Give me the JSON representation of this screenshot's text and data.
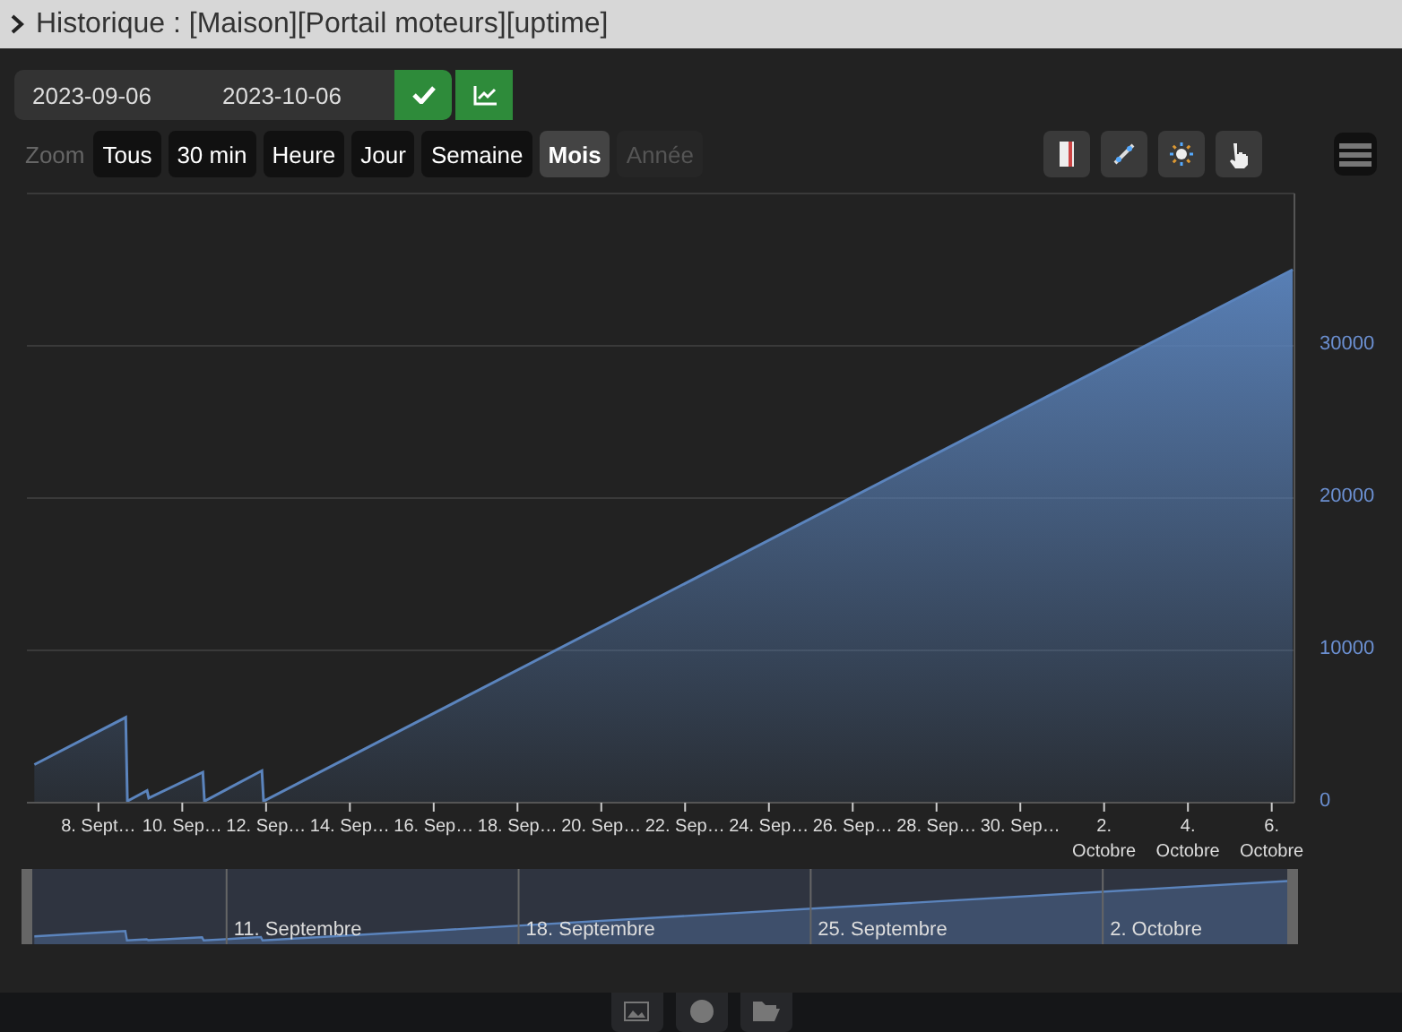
{
  "window": {
    "title": "Historique : [Maison][Portail moteurs][uptime]"
  },
  "date_range": {
    "start": "2023-09-06",
    "end": "2023-10-06"
  },
  "zoom": {
    "label": "Zoom",
    "options": [
      {
        "label": "Tous",
        "selected": false,
        "disabled": false
      },
      {
        "label": "30 min",
        "selected": false,
        "disabled": false
      },
      {
        "label": "Heure",
        "selected": false,
        "disabled": false
      },
      {
        "label": "Jour",
        "selected": false,
        "disabled": false
      },
      {
        "label": "Semaine",
        "selected": false,
        "disabled": false
      },
      {
        "label": "Mois",
        "selected": true,
        "disabled": false
      },
      {
        "label": "Année",
        "selected": false,
        "disabled": true
      }
    ]
  },
  "tools": [
    {
      "kind": "ruler"
    },
    {
      "kind": "line"
    },
    {
      "kind": "sun"
    },
    {
      "kind": "hand"
    }
  ],
  "chart_data": {
    "type": "area",
    "x": [
      "2023-09-06T11:17",
      "2023-09-08T15:36",
      "2023-09-08T16:34",
      "2023-09-09T03:50",
      "2023-09-09T04:48",
      "2023-09-10T11:46",
      "2023-09-10T12:43",
      "2023-09-11T21:36",
      "2023-09-11T22:34",
      "2023-10-06T12:00"
    ],
    "series": [
      {
        "color": "#5b84bd",
        "values": [
          2500,
          5600,
          100,
          800,
          300,
          2000,
          100,
          2100,
          100,
          35000
        ]
      }
    ],
    "xlim": [
      "2023-09-06T07:00",
      "2023-10-06T13:00"
    ],
    "grid": true,
    "ylim": [
      0,
      40000
    ],
    "yticks": [
      0,
      10000,
      20000,
      30000
    ],
    "xticks": [
      {
        "value": "2023-09-08T00:00",
        "label": "8. Sept…"
      },
      {
        "value": "2023-09-10T00:00",
        "label": "10. Sep…"
      },
      {
        "value": "2023-09-12T00:00",
        "label": "12. Sep…"
      },
      {
        "value": "2023-09-14T00:00",
        "label": "14. Sep…"
      },
      {
        "value": "2023-09-16T00:00",
        "label": "16. Sep…"
      },
      {
        "value": "2023-09-18T00:00",
        "label": "18. Sep…"
      },
      {
        "value": "2023-09-20T00:00",
        "label": "20. Sep…"
      },
      {
        "value": "2023-09-22T00:00",
        "label": "22. Sep…"
      },
      {
        "value": "2023-09-24T00:00",
        "label": "24. Sep…"
      },
      {
        "value": "2023-09-26T00:00",
        "label": "26. Sep…"
      },
      {
        "value": "2023-09-28T00:00",
        "label": "28. Sep…"
      },
      {
        "value": "2023-09-30T00:00",
        "label": "30. Sep…"
      },
      {
        "value": "2023-10-02T00:00",
        "label": "2.\nOctobre"
      },
      {
        "value": "2023-10-04T00:00",
        "label": "4.\nOctobre"
      },
      {
        "value": "2023-10-06T00:00",
        "label": "6.\nOctobre"
      }
    ]
  },
  "navigator": {
    "labels": [
      "11. Septembre",
      "18. Septembre",
      "25. Septembre",
      "2. Octobre"
    ]
  },
  "footer_buttons": [
    {
      "kind": "image"
    },
    {
      "kind": "circle"
    },
    {
      "kind": "folder"
    }
  ]
}
